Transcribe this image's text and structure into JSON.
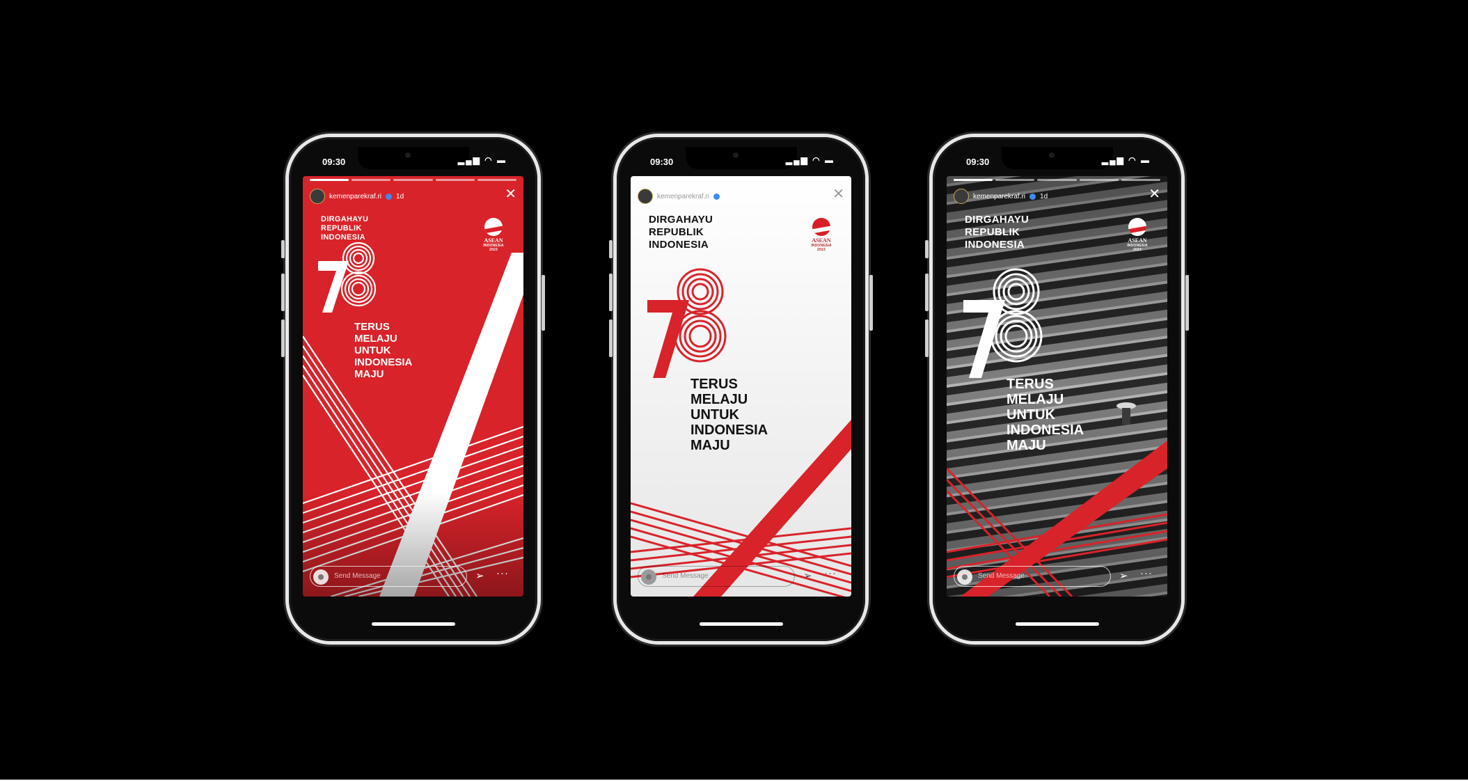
{
  "phones": [
    {
      "variant": "red",
      "status_time": "09:30",
      "account_name": "kemenparekraf.ri",
      "post_age": "1d",
      "headline": [
        "DIRGAHAYU",
        "REPUBLIK",
        "INDONESIA"
      ],
      "asean_label": "ASEAN",
      "asean_sub": "INDONESIA 2023",
      "tagline": [
        "TERUS",
        "MELAJU",
        "UNTUK",
        "INDONESIA",
        "MAJU"
      ],
      "message_placeholder": "Send Message",
      "background": "#d8232a"
    },
    {
      "variant": "white",
      "status_time": "09:30",
      "account_name": "kemenparekraf.ri",
      "post_age": "",
      "headline": [
        "DIRGAHAYU",
        "REPUBLIK",
        "INDONESIA"
      ],
      "asean_label": "ASEAN",
      "asean_sub": "INDONESIA 2023",
      "tagline": [
        "TERUS",
        "MELAJU",
        "UNTUK",
        "INDONESIA",
        "MAJU"
      ],
      "message_placeholder": "Send Message",
      "background": "#f2f2f2"
    },
    {
      "variant": "photo",
      "status_time": "09:30",
      "account_name": "kemenparekraf.ri",
      "post_age": "1d",
      "headline": [
        "DIRGAHAYU",
        "REPUBLIK",
        "INDONESIA"
      ],
      "asean_label": "ASEAN",
      "asean_sub": "INDONESIA 2023",
      "tagline": [
        "TERUS",
        "MELAJU",
        "UNTUK",
        "INDONESIA",
        "MAJU"
      ],
      "message_placeholder": "Send Message",
      "background": "#555555"
    }
  ],
  "icons": {
    "signal": "signal-icon",
    "wifi": "wifi-icon",
    "battery": "battery-icon",
    "close": "close-icon",
    "camera": "camera-icon",
    "send": "send-icon",
    "more": "more-icon"
  },
  "colors": {
    "accent_red": "#d8232a",
    "stage": "#000000"
  }
}
